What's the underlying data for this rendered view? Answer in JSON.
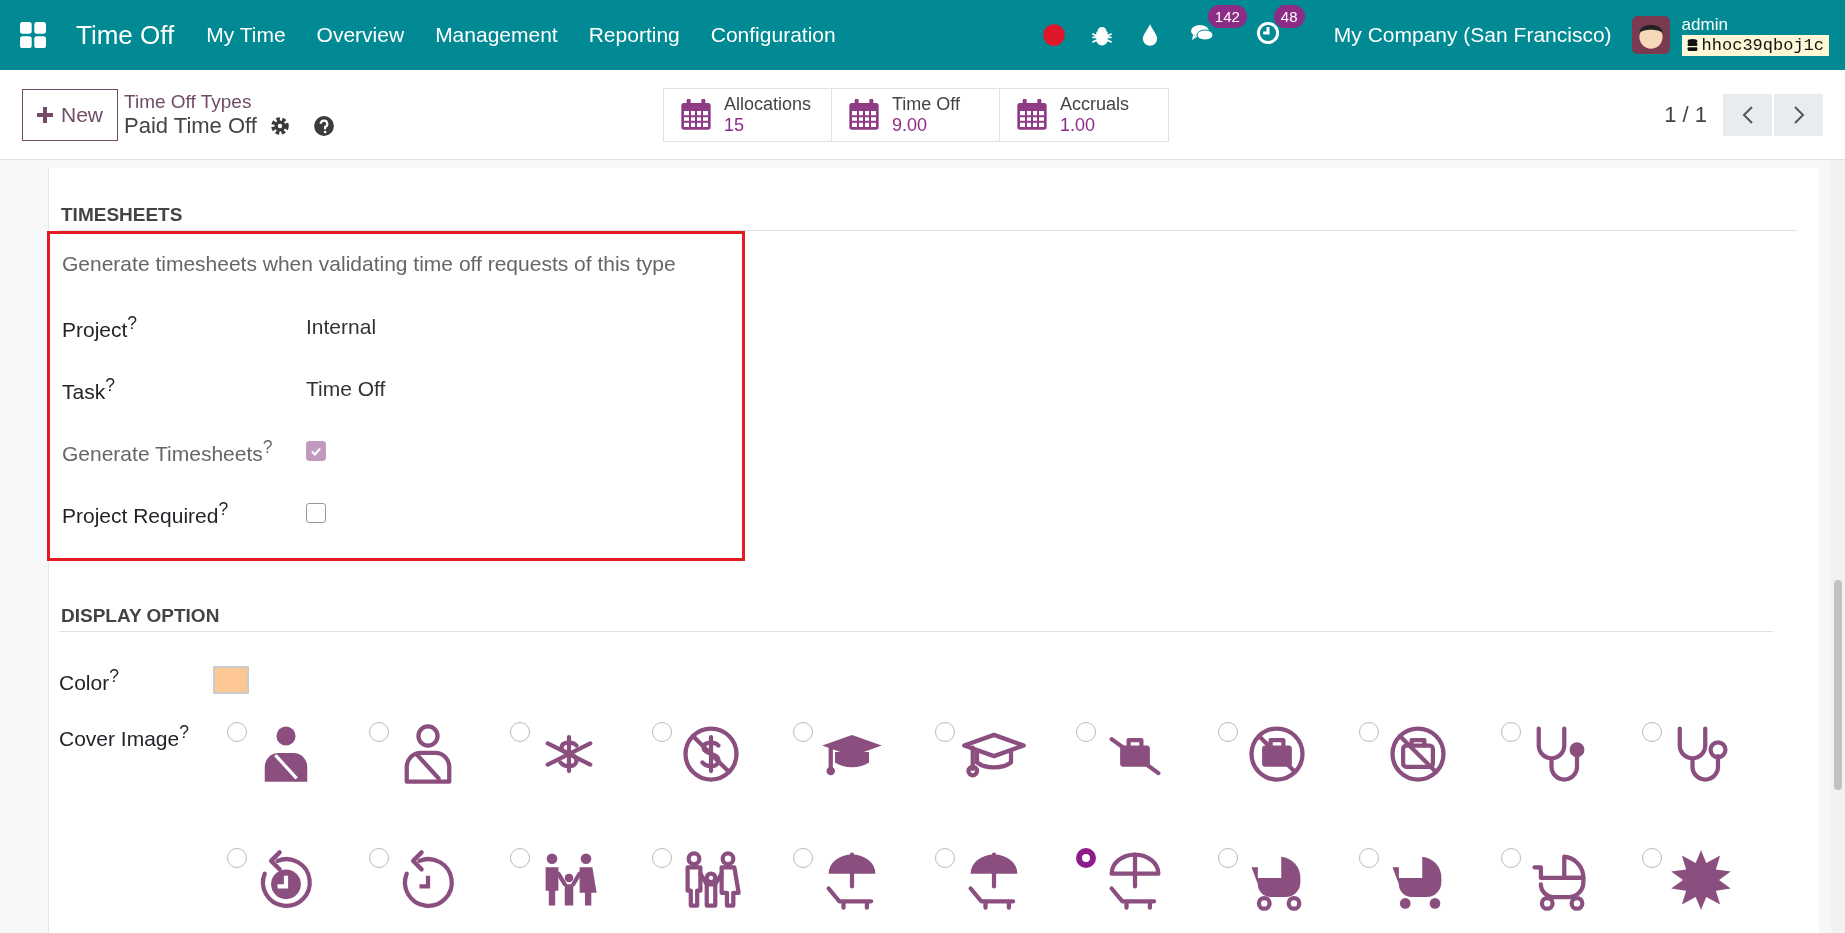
{
  "navbar": {
    "app_title": "Time Off",
    "menu": [
      "My Time",
      "Overview",
      "Management",
      "Reporting",
      "Configuration"
    ],
    "messages_badge": "142",
    "activities_badge": "48",
    "company": "My Company (San Francisco)",
    "user": "admin",
    "database": "hhoc39qboj1c"
  },
  "control_panel": {
    "new_button": "New",
    "breadcrumb": "Time Off Types",
    "record_title": "Paid Time Off",
    "pager": "1 / 1",
    "stat_buttons": [
      {
        "label": "Allocations",
        "value": "15"
      },
      {
        "label": "Time Off",
        "value": "9.00"
      },
      {
        "label": "Accruals",
        "value": "1.00"
      }
    ]
  },
  "timesheets": {
    "heading": "TIMESHEETS",
    "description": "Generate timesheets when validating time off requests of this type",
    "fields": [
      {
        "label": "Project$^{?}$",
        "kind": "text",
        "readonly": false,
        "value": "Internal"
      },
      {
        "label": "Task$^{?}$",
        "kind": "text",
        "readonly": false,
        "value": "Time Off"
      },
      {
        "label": "Generate Timesheets$^{?}$",
        "kind": "checkbox",
        "readonly": true,
        "checked": true
      },
      {
        "label": "Project Required$^{?}$",
        "kind": "checkbox",
        "readonly": false,
        "checked": false
      }
    ]
  },
  "display_option": {
    "heading": "DISPLAY OPTION",
    "color_label": "Color$^{?}$",
    "color": "#fcc792",
    "cover_label": "Cover Image$^{?}$",
    "cover_images": [
      {
        "kind": "injured-fill",
        "selected": false
      },
      {
        "kind": "injured-outline",
        "selected": false
      },
      {
        "kind": "no-money",
        "selected": false
      },
      {
        "kind": "no-money-circle",
        "selected": false
      },
      {
        "kind": "cap-fill",
        "selected": false
      },
      {
        "kind": "cap-outline",
        "selected": false
      },
      {
        "kind": "no-case",
        "selected": false
      },
      {
        "kind": "no-case-circle",
        "selected": false
      },
      {
        "kind": "no-case-circle-outline",
        "selected": false
      },
      {
        "kind": "stethoscope-fill",
        "selected": false
      },
      {
        "kind": "stethoscope-outline",
        "selected": false
      },
      {
        "kind": "clock-back-fill",
        "selected": false
      },
      {
        "kind": "clock-back-outline",
        "selected": false
      },
      {
        "kind": "family-fill",
        "selected": false
      },
      {
        "kind": "family-outline",
        "selected": false
      },
      {
        "kind": "beach-fill",
        "selected": false
      },
      {
        "kind": "beach-fill",
        "selected": false
      },
      {
        "kind": "beach-outline",
        "selected": true
      },
      {
        "kind": "stroller-fill",
        "selected": false
      },
      {
        "kind": "pram-fill",
        "selected": false
      },
      {
        "kind": "stroller-outline",
        "selected": false
      },
      {
        "kind": "extra-badge",
        "selected": false
      }
    ]
  }
}
